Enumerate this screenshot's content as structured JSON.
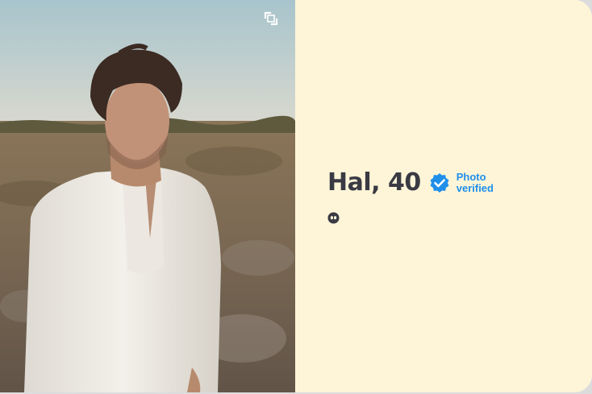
{
  "profile": {
    "name_age": "Hal, 40",
    "verified_line1": "Photo",
    "verified_line2": "verified"
  },
  "icons": {
    "expand": "expand-icon",
    "verified": "verified-badge-icon",
    "quote": "quote-icon"
  },
  "colors": {
    "panel_background": "#fef5d8",
    "name_text": "#3a3a44",
    "verified_blue": "#1f8fea"
  }
}
